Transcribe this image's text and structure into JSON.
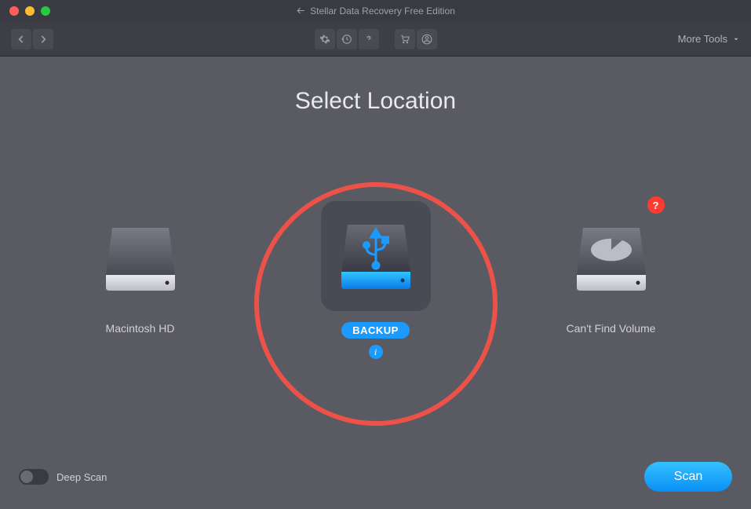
{
  "window": {
    "title": "Stellar Data Recovery Free Edition"
  },
  "toolbar": {
    "more_tools": "More Tools"
  },
  "heading": "Select Location",
  "drives": [
    {
      "label": "Macintosh HD",
      "type": "internal",
      "selected": false,
      "warning": false
    },
    {
      "label": "BACKUP",
      "type": "usb",
      "selected": true,
      "warning": false
    },
    {
      "label": "Can't Find Volume",
      "type": "unknown",
      "selected": false,
      "warning": true
    }
  ],
  "footer": {
    "deep_scan_label": "Deep Scan",
    "deep_scan_on": false,
    "scan_label": "Scan"
  },
  "icons": {
    "info": "i",
    "question": "?"
  }
}
